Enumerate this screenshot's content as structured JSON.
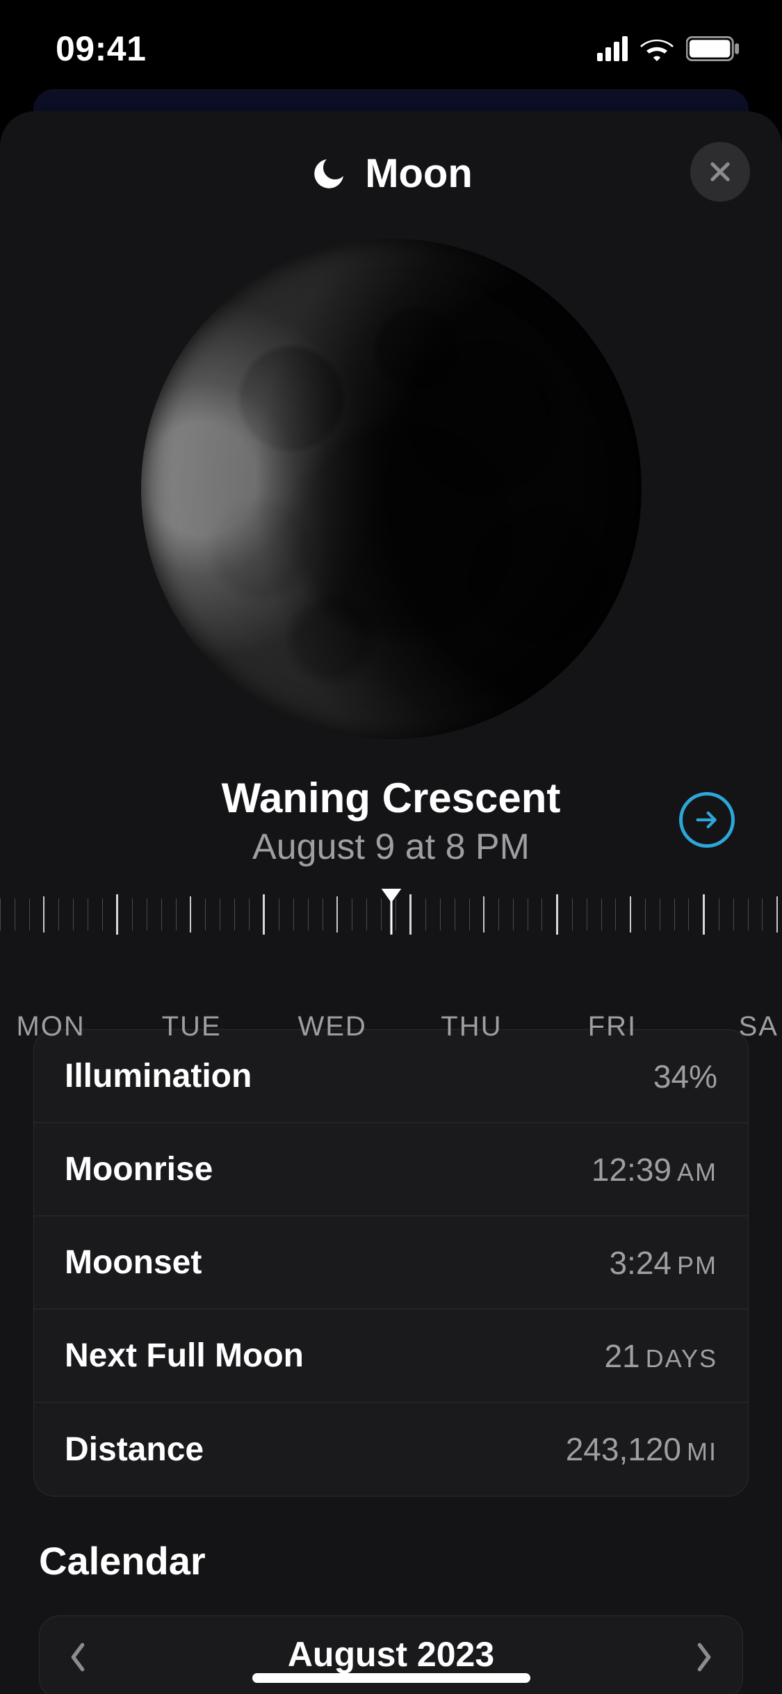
{
  "status": {
    "time": "09:41"
  },
  "header": {
    "title": "Moon",
    "close_label": "Close"
  },
  "phase": {
    "name": "Waning Crescent",
    "datetime": "August 9 at 8 PM"
  },
  "ruler": {
    "days": [
      "MON",
      "TUE",
      "WED",
      "THU",
      "FRI",
      "SA"
    ]
  },
  "stats": [
    {
      "label": "Illumination",
      "value": "34%",
      "unit": ""
    },
    {
      "label": "Moonrise",
      "value": "12:39",
      "unit": "AM"
    },
    {
      "label": "Moonset",
      "value": "3:24",
      "unit": "PM"
    },
    {
      "label": "Next Full Moon",
      "value": "21",
      "unit": "DAYS"
    },
    {
      "label": "Distance",
      "value": "243,120",
      "unit": "MI"
    }
  ],
  "calendar": {
    "heading": "Calendar",
    "month": "August 2023"
  }
}
